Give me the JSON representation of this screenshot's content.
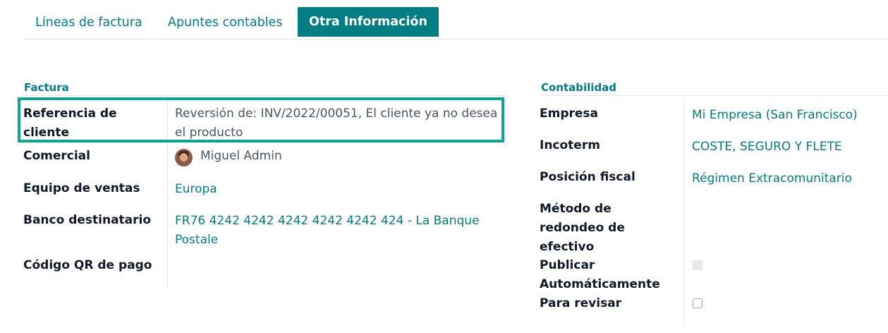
{
  "tabs": [
    {
      "label": "Líneas de factura",
      "active": false
    },
    {
      "label": "Apuntes contables",
      "active": false
    },
    {
      "label": "Otra Información",
      "active": true
    }
  ],
  "factura": {
    "title": "Factura",
    "fields": {
      "referencia": {
        "label_line1": "Referencia de",
        "label_line2": "cliente",
        "value_line1": "Reversión de: INV/2022/00051, El cliente ya no desea",
        "value_line2": "el producto"
      },
      "comercial": {
        "label": "Comercial",
        "value": "Miguel Admin"
      },
      "equipo": {
        "label": "Equipo de ventas",
        "value": "Europa"
      },
      "banco": {
        "label": "Banco destinatario",
        "value_line1": "FR76 4242 4242 4242 4242 4242 424 - La Banque",
        "value_line2": "Postale"
      },
      "qr": {
        "label": "Código QR de pago"
      }
    }
  },
  "contabilidad": {
    "title": "Contabilidad",
    "fields": {
      "empresa": {
        "label": "Empresa",
        "value": "Mi Empresa (San Francisco)"
      },
      "incoterm": {
        "label": "Incoterm",
        "value": "COSTE, SEGURO Y FLETE"
      },
      "posicion": {
        "label": "Posición fiscal",
        "value": "Régimen Extracomunitario"
      },
      "redondeo": {
        "label_line1": "Método de",
        "label_line2": "redondeo de",
        "label_line3": "efectivo"
      },
      "publicar": {
        "label_line1": "Publicar",
        "label_line2": "Automáticamente",
        "checked": false,
        "disabled": true
      },
      "revisar": {
        "label": "Para revisar",
        "checked": false
      }
    }
  },
  "colors": {
    "accent": "#017e84",
    "highlight": "#0aa595"
  }
}
